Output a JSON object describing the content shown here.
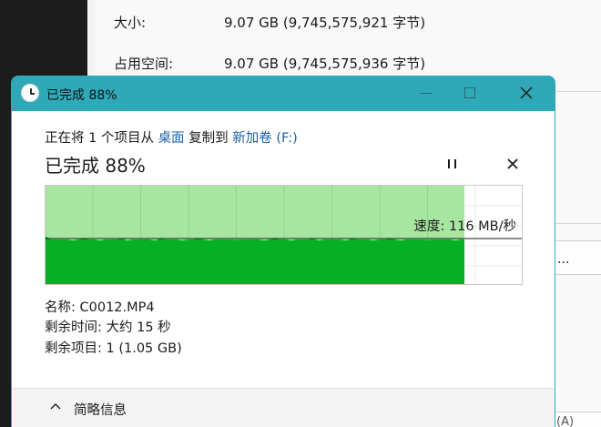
{
  "background_window": {
    "properties": [
      {
        "label": "大小:",
        "value": "9.07 GB (9,745,575,921 字节)"
      },
      {
        "label": "占用空间:",
        "value": "9.07 GB (9,745,575,936 字节)"
      }
    ],
    "button_label": "...",
    "bottom_button_label": "(A)"
  },
  "dialog": {
    "title": "已完成 88%",
    "description": {
      "prefix": "正在将 1 个项目从 ",
      "source": "桌面",
      "middle": " 复制到 ",
      "destination": "新加卷 (F:)"
    },
    "heading": "已完成 88%",
    "speed_label": "速度: 116 MB/秒",
    "details": [
      {
        "label": "名称:",
        "value": "C0012.MP4"
      },
      {
        "label": "剩余时间:",
        "value": "大约 15 秒"
      },
      {
        "label": "剩余项目:",
        "value": "1 (1.05 GB)"
      }
    ],
    "footer_toggle_label": "简略信息",
    "progress_fraction": 0.88,
    "colors": {
      "titlebar": "#2fa9b8",
      "progress_light": "#a6e6a0",
      "progress_dark": "#06b023",
      "link": "#1f5fa8"
    }
  }
}
